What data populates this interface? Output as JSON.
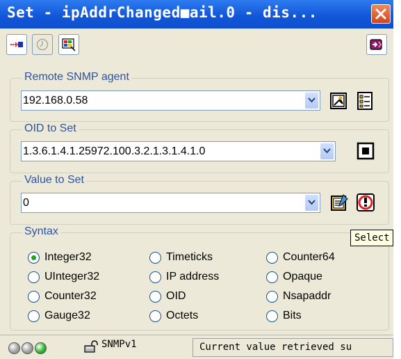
{
  "window": {
    "title": "Set - ipAddrChanged■ail.0 - dis..."
  },
  "toolbar": {
    "buttons": [
      {
        "icon": "arrow-to-box-icon"
      },
      {
        "icon": "disabled-clock-icon"
      },
      {
        "icon": "windows-flag-icon"
      },
      {
        "icon": "exit-icon"
      }
    ]
  },
  "remote_agent": {
    "legend": "Remote SNMP agent",
    "value": "192.168.0.58"
  },
  "oid": {
    "legend": "OID to Set",
    "value": "1.3.6.1.4.1.25972.100.3.2.1.3.1.4.1.0"
  },
  "value_to_set": {
    "legend": "Value to Set",
    "value": "0"
  },
  "syntax": {
    "legend": "Syntax",
    "selected": "Integer32",
    "options": [
      "Integer32",
      "Timeticks",
      "Counter64",
      "UInteger32",
      "IP address",
      "Opaque",
      "Counter32",
      "OID",
      "Nsapaddr",
      "Gauge32",
      "Octets",
      "Bits"
    ]
  },
  "tooltip": {
    "text": "Select"
  },
  "status": {
    "lights": [
      "#9a9a9a",
      "#9a9a9a",
      "#22b022"
    ],
    "version": "SNMPv1",
    "message": "Current value retrieved su"
  },
  "colors": {
    "title_bar": "#1257d8",
    "legend_text": "#2d53a0",
    "radio_dot": "#21a121"
  }
}
